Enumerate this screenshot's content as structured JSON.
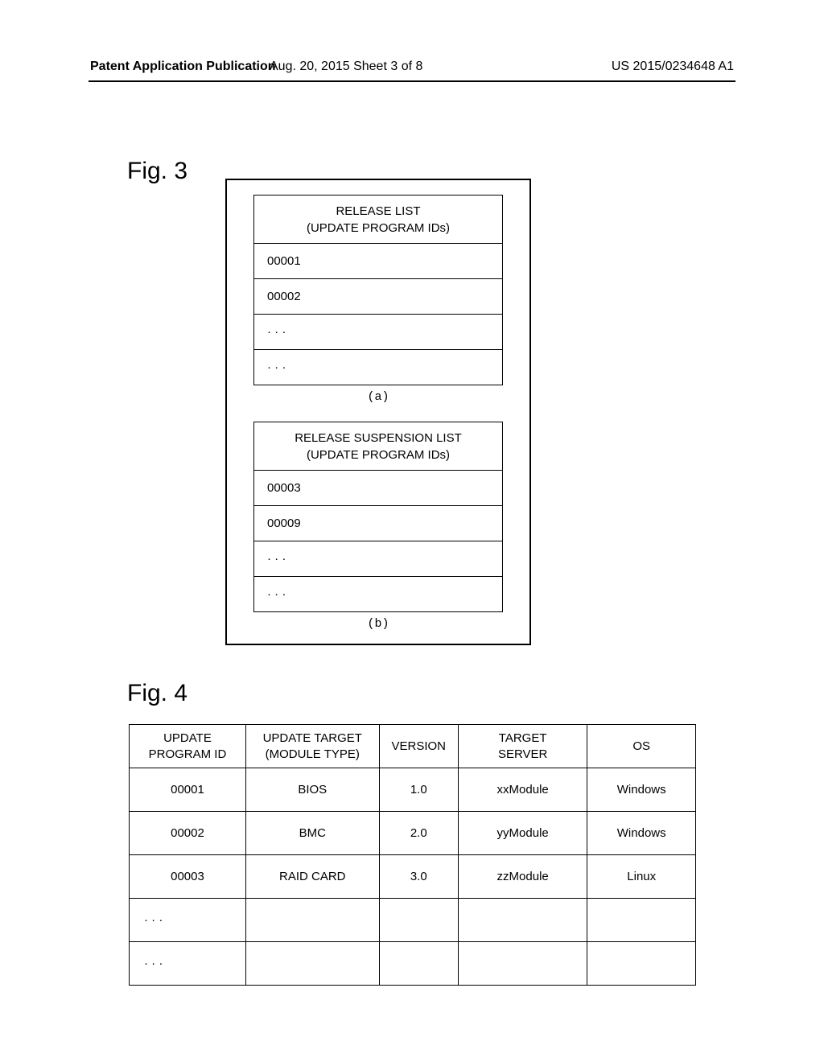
{
  "header": {
    "left": "Patent Application Publication",
    "mid": "Aug. 20, 2015  Sheet 3 of 8",
    "right": "US 2015/0234648 A1"
  },
  "fig3": {
    "label": "Fig. 3",
    "tableA": {
      "header_l1": "RELEASE LIST",
      "header_l2": "(UPDATE PROGRAM IDs)",
      "rows": [
        "00001",
        "00002",
        "· · ·",
        "· · ·"
      ],
      "caption": "(a)"
    },
    "tableB": {
      "header_l1": "RELEASE SUSPENSION LIST",
      "header_l2": "(UPDATE PROGRAM IDs)",
      "rows": [
        "00003",
        "00009",
        "· · ·",
        "· · ·"
      ],
      "caption": "(b)"
    }
  },
  "fig4": {
    "label": "Fig. 4",
    "headers": {
      "id_l1": "UPDATE",
      "id_l2": "PROGRAM ID",
      "tgt_l1": "UPDATE TARGET",
      "tgt_l2": "(MODULE TYPE)",
      "ver": "VERSION",
      "srv_l1": "TARGET",
      "srv_l2": "SERVER",
      "os": "OS"
    },
    "rows": [
      {
        "id": "00001",
        "tgt": "BIOS",
        "ver": "1.0",
        "srv": "xxModule",
        "os": "Windows"
      },
      {
        "id": "00002",
        "tgt": "BMC",
        "ver": "2.0",
        "srv": "yyModule",
        "os": "Windows"
      },
      {
        "id": "00003",
        "tgt": "RAID CARD",
        "ver": "3.0",
        "srv": "zzModule",
        "os": "Linux"
      },
      {
        "id": "· · ·",
        "tgt": "",
        "ver": "",
        "srv": "",
        "os": ""
      },
      {
        "id": "· · ·",
        "tgt": "",
        "ver": "",
        "srv": "",
        "os": ""
      }
    ]
  },
  "chart_data": [
    {
      "type": "table",
      "title": "RELEASE LIST (UPDATE PROGRAM IDs)",
      "columns": [
        "UPDATE PROGRAM ID"
      ],
      "rows": [
        [
          "00001"
        ],
        [
          "00002"
        ],
        [
          "..."
        ],
        [
          "..."
        ]
      ]
    },
    {
      "type": "table",
      "title": "RELEASE SUSPENSION LIST (UPDATE PROGRAM IDs)",
      "columns": [
        "UPDATE PROGRAM ID"
      ],
      "rows": [
        [
          "00003"
        ],
        [
          "00009"
        ],
        [
          "..."
        ],
        [
          "..."
        ]
      ]
    },
    {
      "type": "table",
      "title": "Fig. 4",
      "columns": [
        "UPDATE PROGRAM ID",
        "UPDATE TARGET (MODULE TYPE)",
        "VERSION",
        "TARGET SERVER",
        "OS"
      ],
      "rows": [
        [
          "00001",
          "BIOS",
          "1.0",
          "xxModule",
          "Windows"
        ],
        [
          "00002",
          "BMC",
          "2.0",
          "yyModule",
          "Windows"
        ],
        [
          "00003",
          "RAID CARD",
          "3.0",
          "zzModule",
          "Linux"
        ],
        [
          "...",
          "",
          "",
          "",
          ""
        ],
        [
          "...",
          "",
          "",
          "",
          ""
        ]
      ]
    }
  ]
}
